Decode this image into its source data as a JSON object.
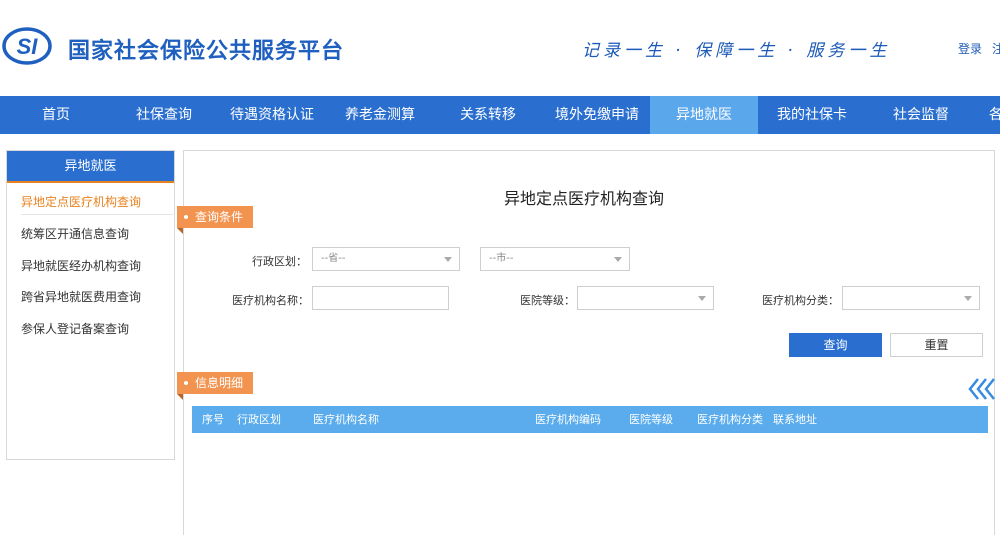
{
  "header": {
    "logo_text": "SI",
    "site_title": "国家社会保险公共服务平台",
    "slogan": "记录一生 · 保障一生 · 服务一生",
    "login": "登录",
    "register": "注"
  },
  "nav": {
    "items": [
      {
        "label": "首页"
      },
      {
        "label": "社保查询"
      },
      {
        "label": "待遇资格认证"
      },
      {
        "label": "养老金测算"
      },
      {
        "label": "关系转移"
      },
      {
        "label": "境外免缴申请"
      },
      {
        "label": "异地就医",
        "active": true
      },
      {
        "label": "我的社保卡"
      },
      {
        "label": "社会监督"
      },
      {
        "label": "各"
      }
    ]
  },
  "sidebar": {
    "heading": "异地就医",
    "items": [
      {
        "label": "异地定点医疗机构查询",
        "active": true
      },
      {
        "label": "统筹区开通信息查询"
      },
      {
        "label": "异地就医经办机构查询"
      },
      {
        "label": "跨省异地就医费用查询"
      },
      {
        "label": "参保人登记备案查询"
      }
    ]
  },
  "main": {
    "title": "异地定点医疗机构查询",
    "query_section": "查询条件",
    "detail_section": "信息明细",
    "form": {
      "region_label": "行政区划：",
      "province_value": "--省--",
      "city_value": "--市--",
      "name_label": "医疗机构名称：",
      "name_value": "",
      "level_label": "医院等级：",
      "level_value": "",
      "category_label": "医疗机构分类：",
      "category_value": ""
    },
    "buttons": {
      "query": "查询",
      "reset": "重置"
    },
    "table": {
      "columns": [
        "序号",
        "行政区划",
        "医疗机构名称",
        "医疗机构编码",
        "医院等级",
        "医疗机构分类",
        "联系地址"
      ],
      "rows": []
    }
  },
  "colors": {
    "nav_bg": "#2a6fcf",
    "nav_active": "#5aa7ec",
    "accent_orange": "#f29450",
    "table_header": "#5aaced",
    "title_blue": "#1f5fbf"
  }
}
